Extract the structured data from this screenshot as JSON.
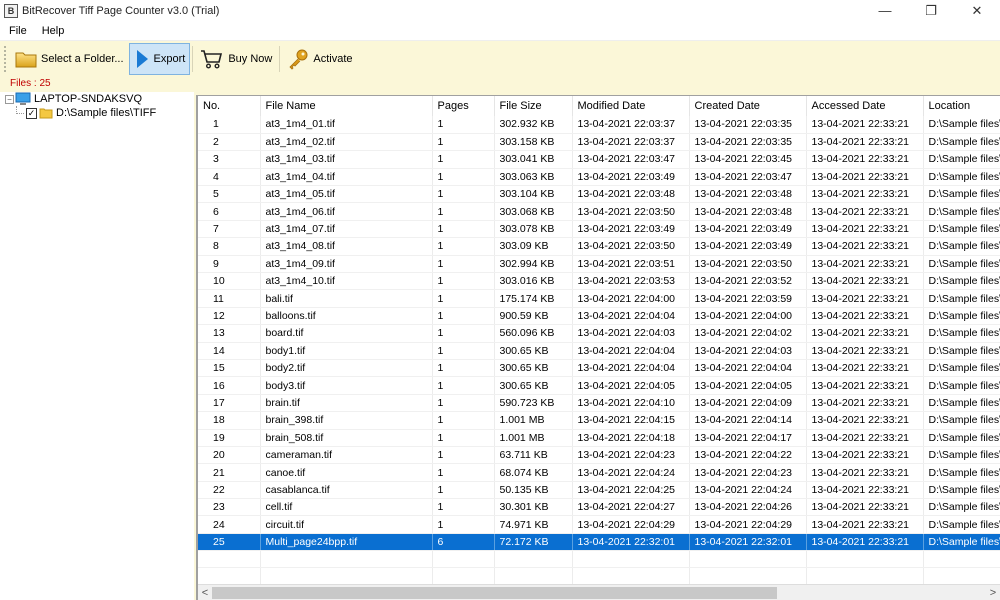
{
  "window": {
    "title": "BitRecover Tiff Page Counter v3.0 (Trial)",
    "app_icon_letter": "B",
    "minimize": "—",
    "maximize": "❐",
    "close": "✕"
  },
  "menu": [
    "File",
    "Help"
  ],
  "toolbar": {
    "select_folder": "Select a Folder...",
    "export": "Export",
    "buy_now": "Buy Now",
    "activate": "Activate"
  },
  "status": {
    "files_count": "Files : 25"
  },
  "tree": {
    "root": "LAPTOP-SNDAKSVQ",
    "root_expander": "−",
    "child": "D:\\Sample files\\TIFF",
    "child_checked": "✓"
  },
  "table": {
    "columns": [
      "No.",
      "File Name",
      "Pages",
      "File Size",
      "Modified Date",
      "Created Date",
      "Accessed Date",
      "Location"
    ],
    "rows": [
      [
        "1",
        "at3_1m4_01.tif",
        "1",
        "302.932 KB",
        "13-04-2021 22:03:37",
        "13-04-2021 22:03:35",
        "13-04-2021 22:33:21",
        "D:\\Sample files\\"
      ],
      [
        "2",
        "at3_1m4_02.tif",
        "1",
        "303.158 KB",
        "13-04-2021 22:03:37",
        "13-04-2021 22:03:35",
        "13-04-2021 22:33:21",
        "D:\\Sample files\\"
      ],
      [
        "3",
        "at3_1m4_03.tif",
        "1",
        "303.041 KB",
        "13-04-2021 22:03:47",
        "13-04-2021 22:03:45",
        "13-04-2021 22:33:21",
        "D:\\Sample files\\"
      ],
      [
        "4",
        "at3_1m4_04.tif",
        "1",
        "303.063 KB",
        "13-04-2021 22:03:49",
        "13-04-2021 22:03:47",
        "13-04-2021 22:33:21",
        "D:\\Sample files\\"
      ],
      [
        "5",
        "at3_1m4_05.tif",
        "1",
        "303.104 KB",
        "13-04-2021 22:03:48",
        "13-04-2021 22:03:48",
        "13-04-2021 22:33:21",
        "D:\\Sample files\\"
      ],
      [
        "6",
        "at3_1m4_06.tif",
        "1",
        "303.068 KB",
        "13-04-2021 22:03:50",
        "13-04-2021 22:03:48",
        "13-04-2021 22:33:21",
        "D:\\Sample files\\"
      ],
      [
        "7",
        "at3_1m4_07.tif",
        "1",
        "303.078 KB",
        "13-04-2021 22:03:49",
        "13-04-2021 22:03:49",
        "13-04-2021 22:33:21",
        "D:\\Sample files\\"
      ],
      [
        "8",
        "at3_1m4_08.tif",
        "1",
        "303.09 KB",
        "13-04-2021 22:03:50",
        "13-04-2021 22:03:49",
        "13-04-2021 22:33:21",
        "D:\\Sample files\\"
      ],
      [
        "9",
        "at3_1m4_09.tif",
        "1",
        "302.994 KB",
        "13-04-2021 22:03:51",
        "13-04-2021 22:03:50",
        "13-04-2021 22:33:21",
        "D:\\Sample files\\"
      ],
      [
        "10",
        "at3_1m4_10.tif",
        "1",
        "303.016 KB",
        "13-04-2021 22:03:53",
        "13-04-2021 22:03:52",
        "13-04-2021 22:33:21",
        "D:\\Sample files\\"
      ],
      [
        "11",
        "bali.tif",
        "1",
        "175.174 KB",
        "13-04-2021 22:04:00",
        "13-04-2021 22:03:59",
        "13-04-2021 22:33:21",
        "D:\\Sample files\\"
      ],
      [
        "12",
        "balloons.tif",
        "1",
        "900.59 KB",
        "13-04-2021 22:04:04",
        "13-04-2021 22:04:00",
        "13-04-2021 22:33:21",
        "D:\\Sample files\\"
      ],
      [
        "13",
        "board.tif",
        "1",
        "560.096 KB",
        "13-04-2021 22:04:03",
        "13-04-2021 22:04:02",
        "13-04-2021 22:33:21",
        "D:\\Sample files\\"
      ],
      [
        "14",
        "body1.tif",
        "1",
        "300.65 KB",
        "13-04-2021 22:04:04",
        "13-04-2021 22:04:03",
        "13-04-2021 22:33:21",
        "D:\\Sample files\\"
      ],
      [
        "15",
        "body2.tif",
        "1",
        "300.65 KB",
        "13-04-2021 22:04:04",
        "13-04-2021 22:04:04",
        "13-04-2021 22:33:21",
        "D:\\Sample files\\"
      ],
      [
        "16",
        "body3.tif",
        "1",
        "300.65 KB",
        "13-04-2021 22:04:05",
        "13-04-2021 22:04:05",
        "13-04-2021 22:33:21",
        "D:\\Sample files\\"
      ],
      [
        "17",
        "brain.tif",
        "1",
        "590.723 KB",
        "13-04-2021 22:04:10",
        "13-04-2021 22:04:09",
        "13-04-2021 22:33:21",
        "D:\\Sample files\\"
      ],
      [
        "18",
        "brain_398.tif",
        "1",
        "1.001 MB",
        "13-04-2021 22:04:15",
        "13-04-2021 22:04:14",
        "13-04-2021 22:33:21",
        "D:\\Sample files\\"
      ],
      [
        "19",
        "brain_508.tif",
        "1",
        "1.001 MB",
        "13-04-2021 22:04:18",
        "13-04-2021 22:04:17",
        "13-04-2021 22:33:21",
        "D:\\Sample files\\"
      ],
      [
        "20",
        "cameraman.tif",
        "1",
        "63.711 KB",
        "13-04-2021 22:04:23",
        "13-04-2021 22:04:22",
        "13-04-2021 22:33:21",
        "D:\\Sample files\\"
      ],
      [
        "21",
        "canoe.tif",
        "1",
        "68.074 KB",
        "13-04-2021 22:04:24",
        "13-04-2021 22:04:23",
        "13-04-2021 22:33:21",
        "D:\\Sample files\\"
      ],
      [
        "22",
        "casablanca.tif",
        "1",
        "50.135 KB",
        "13-04-2021 22:04:25",
        "13-04-2021 22:04:24",
        "13-04-2021 22:33:21",
        "D:\\Sample files\\"
      ],
      [
        "23",
        "cell.tif",
        "1",
        "30.301 KB",
        "13-04-2021 22:04:27",
        "13-04-2021 22:04:26",
        "13-04-2021 22:33:21",
        "D:\\Sample files\\"
      ],
      [
        "24",
        "circuit.tif",
        "1",
        "74.971 KB",
        "13-04-2021 22:04:29",
        "13-04-2021 22:04:29",
        "13-04-2021 22:33:21",
        "D:\\Sample files\\"
      ],
      [
        "25",
        "Multi_page24bpp.tif",
        "6",
        "72.172 KB",
        "13-04-2021 22:32:01",
        "13-04-2021 22:32:01",
        "13-04-2021 22:33:21",
        "D:\\Sample files\\"
      ]
    ],
    "selected_row_index": 24,
    "selection_color": "#0a6fd1"
  },
  "scrollbar": {
    "left_arrow": "<",
    "right_arrow": ">",
    "position_fraction": 0.0,
    "visible_fraction": 0.73
  },
  "colors": {
    "toolbar_bg": "#fbf7d8",
    "status_text": "#c00000",
    "export_active_bg": "#cde4f7"
  }
}
